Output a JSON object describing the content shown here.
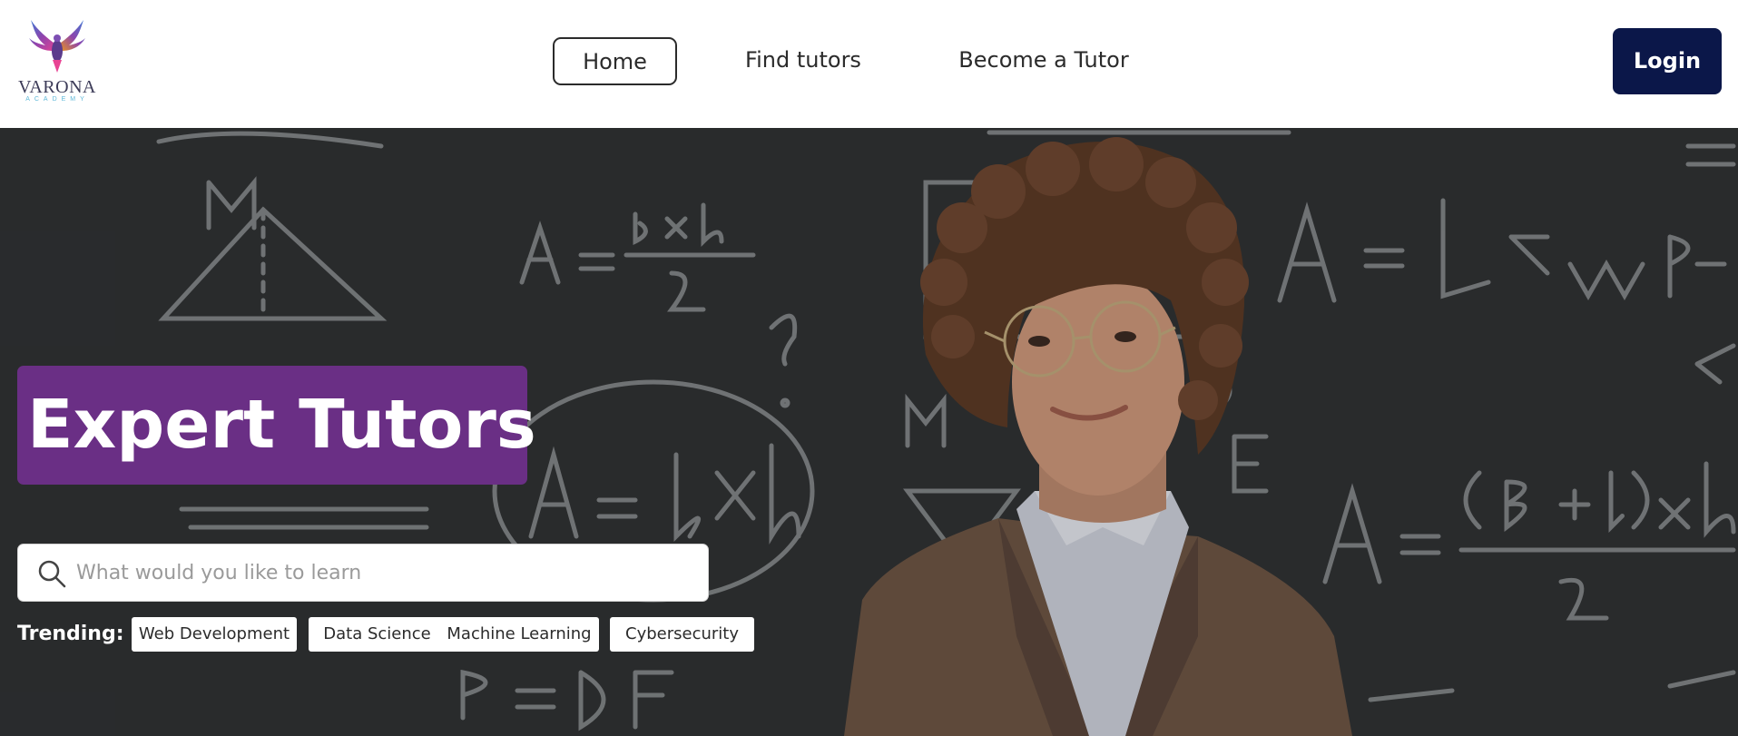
{
  "brand": {
    "name": "VARONA",
    "subtitle": "ACADEMY"
  },
  "nav": {
    "items": [
      {
        "label": "Home",
        "active": true
      },
      {
        "label": "Find tutors",
        "active": false
      },
      {
        "label": "Become a Tutor",
        "active": false
      }
    ],
    "login_label": "Login"
  },
  "hero": {
    "headline": "Expert Tutors",
    "search": {
      "placeholder": "What would you like to learn",
      "value": ""
    },
    "trending": {
      "label": "Trending:",
      "tags": [
        "Web Development",
        "Data Science",
        "Machine Learning",
        "Cybersecurity"
      ]
    }
  },
  "colors": {
    "brand_purple": "#6a2f85",
    "login_navy": "#0b1749",
    "chalkboard": "#2e3032"
  },
  "icons": {
    "logo": "phoenix-logo-icon",
    "search": "search-icon"
  }
}
